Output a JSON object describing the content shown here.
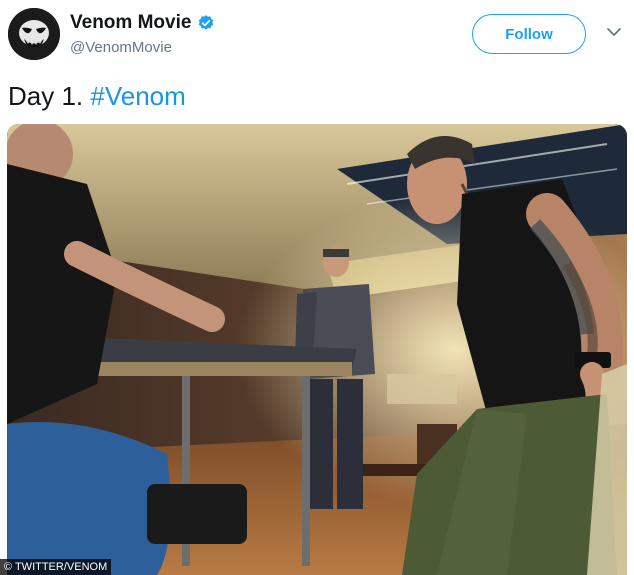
{
  "tweet": {
    "author_name": "Venom Movie",
    "author_handle": "@VenomMovie",
    "follow_label": "Follow",
    "text_prefix": "Day 1.",
    "hashtag": "#Venom",
    "photo_credit": "© TWITTER/VENOM"
  },
  "colors": {
    "accent": "#1da1f2",
    "hashtag": "#1b95e0"
  },
  "icons": {
    "verified": "verified-badge-icon",
    "menu": "chevron-down-icon"
  }
}
